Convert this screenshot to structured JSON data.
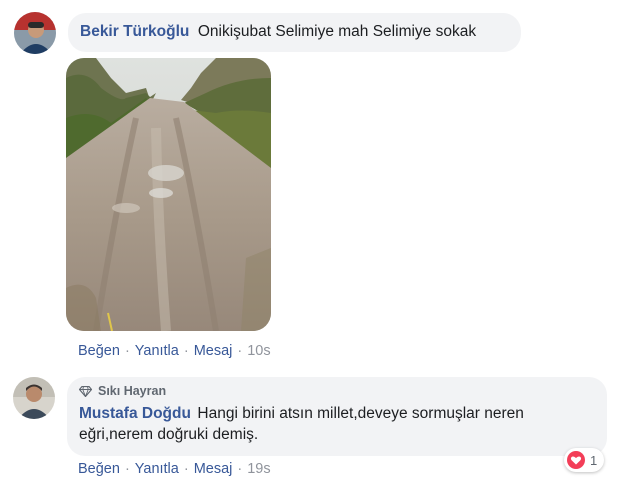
{
  "comment1": {
    "author": "Bekir Türkoğlu",
    "text": "Onikişubat Selimiye mah Selimiye sokak",
    "photo_alt": "muddy dirt road photo",
    "actions": {
      "like": "Beğen",
      "reply": "Yanıtla",
      "message": "Mesaj",
      "time": "10s"
    }
  },
  "comment2": {
    "badge": "Sıkı Hayran",
    "author": "Mustafa Doğdu",
    "text_line1": "Hangi birini atsın millet,deveye sormuşlar neren",
    "text_line2": "eğri,nerem doğruki demiş.",
    "actions": {
      "like": "Beğen",
      "reply": "Yanıtla",
      "message": "Mesaj",
      "time": "19s"
    },
    "reaction": {
      "icon": "heart-icon",
      "count": "1"
    }
  },
  "colors": {
    "link": "#385898",
    "bubble": "#f2f3f5",
    "heart": "#f33e58"
  }
}
